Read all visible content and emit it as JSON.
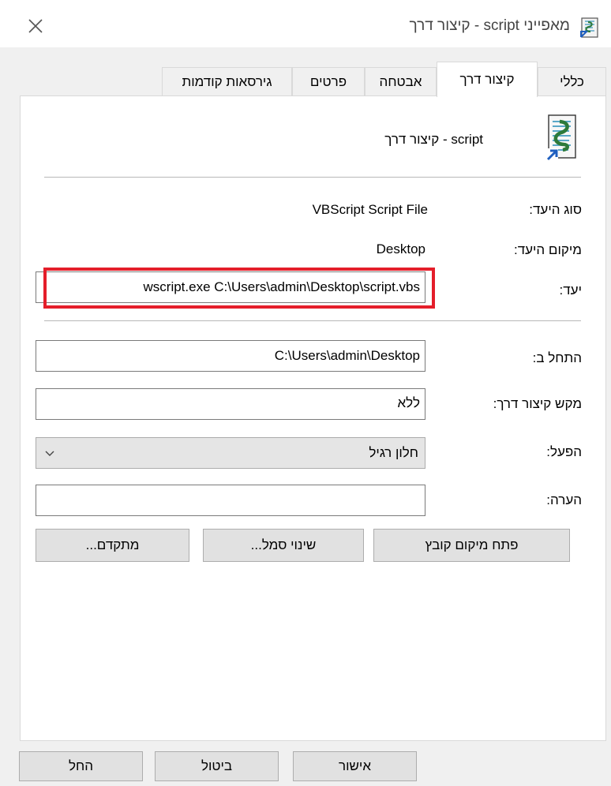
{
  "window": {
    "title": "מאפייני script - קיצור דרך"
  },
  "tabs": [
    {
      "label": "כללי"
    },
    {
      "label": "קיצור דרך"
    },
    {
      "label": "אבטחה"
    },
    {
      "label": "פרטים"
    },
    {
      "label": "גירסאות קודמות"
    }
  ],
  "shortcut": {
    "name": "script - קיצור דרך",
    "target_type_label": "סוג היעד:",
    "target_type_value": "VBScript Script File",
    "target_location_label": "מיקום היעד:",
    "target_location_value": "Desktop",
    "target_label": "יעד:",
    "target_value": "wscript.exe C:\\Users\\admin\\Desktop\\script.vbs",
    "start_in_label": "התחל ב:",
    "start_in_value": "C:\\Users\\admin\\Desktop",
    "shortcut_key_label": "מקש קיצור דרך:",
    "shortcut_key_value": "ללא",
    "run_label": "הפעל:",
    "run_value": "חלון רגיל",
    "comment_label": "הערה:",
    "comment_value": ""
  },
  "actions": {
    "open_location": "פתח מיקום קובץ",
    "change_icon": "שינוי סמל...",
    "advanced": "מתקדם..."
  },
  "footer": {
    "ok": "אישור",
    "cancel": "ביטול",
    "apply": "החל"
  },
  "colors": {
    "highlight": "#e41e2a",
    "panel_bg": "#ffffff",
    "window_bg": "#f0f0f0"
  },
  "icons": {
    "title": "script-file-icon",
    "shortcut": "shortcut-arrow-icon",
    "close": "close-icon",
    "dropdown": "chevron-down-icon"
  }
}
